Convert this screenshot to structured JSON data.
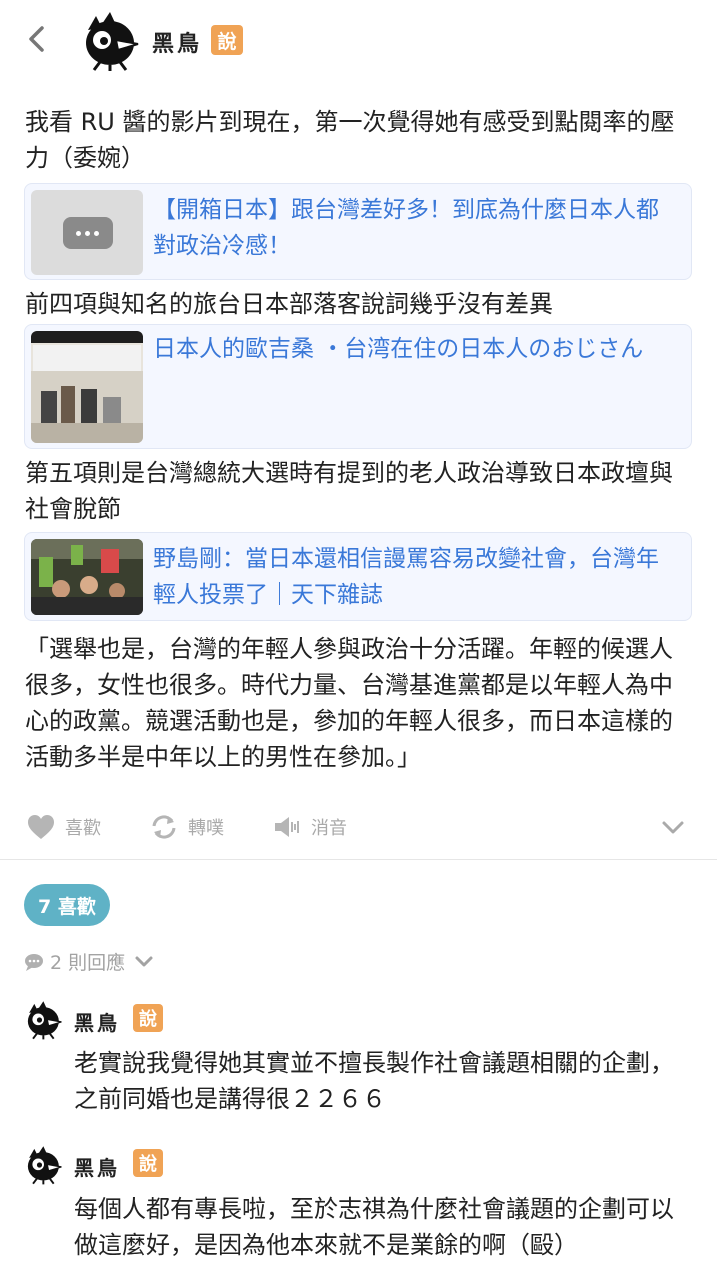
{
  "header": {
    "author_name": "黑鳥",
    "verb": "說"
  },
  "post": {
    "paragraph_1": "我看 RU 醬的影片到現在，第一次覺得她有感受到點閱率的壓力（委婉）",
    "link_1_title": "【開箱日本】跟台灣差好多！到底為什麼日本人都對政治冷感！",
    "paragraph_2": "前四項與知名的旅台日本部落客說詞幾乎沒有差異",
    "link_2_title": "日本人的歐吉桑 ・台湾在住の日本人のおじさん",
    "paragraph_3": "第五項則是台灣總統大選時有提到的老人政治導致日本政壇與社會脫節",
    "link_3_title": "野島剛：當日本還相信謾罵容易改變社會，台灣年輕人投票了｜天下雜誌",
    "quote": "「選舉也是，台灣的年輕人參與政治十分活躍。年輕的候選人很多，女性也很多。時代力量、台灣基進黨都是以年輕人為中心的政黨。競選活動也是，參加的年輕人很多，而日本這樣的活動多半是中年以上的男性在參加。」"
  },
  "actions": {
    "like": "喜歡",
    "replurk": "轉噗",
    "mute": "消音"
  },
  "likes_pill": "7 喜歡",
  "replies_toggle": "2 則回應",
  "responses": [
    {
      "name": "黑鳥",
      "verb": "說",
      "text": "老實說我覺得她其實並不擅長製作社會議題相關的企劃，之前同婚也是講得很２２６６"
    },
    {
      "name": "黑鳥",
      "verb": "說",
      "text": "每個人都有專長啦，至於志祺為什麼社會議題的企劃可以做這麼好，是因為他本來就不是業餘的啊（毆）"
    }
  ],
  "colors": {
    "link": "#3a78d8",
    "badge": "#f0a355",
    "likes_pill": "#5fb2c6",
    "muted": "#a9a9a9"
  }
}
